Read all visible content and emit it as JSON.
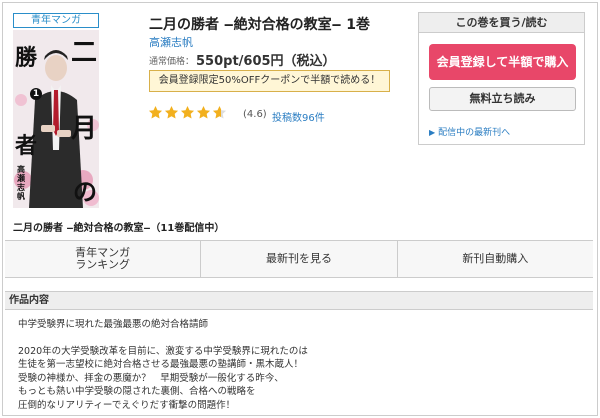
{
  "product": {
    "genre_badge": "青年マンガ",
    "title": "二月の勝者 ‒絶対合格の教室‒ 1巻",
    "author": "高瀬志帆",
    "price_label": "通常価格：",
    "price": "550pt/605円（税込）",
    "coupon": "会員登録限定50%OFFクーポンで半額で読める！",
    "rating": "(4.6)",
    "rating_value": 4.6,
    "review_link": "投稿数96件",
    "series_title": "二月の勝者 ‒絶対合格の教室‒（11巻配信中）"
  },
  "cover": {
    "title_chars": [
      "勝",
      "者",
      "二",
      "月",
      "の"
    ],
    "volume": "1",
    "author_vertical": "高瀬志帆"
  },
  "buy_box": {
    "header": "この巻を買う/読む",
    "register_button": "会員登録して半額で購入",
    "free_button": "無料立ち読み",
    "latest_link": "配信中の最新刊へ"
  },
  "nav": {
    "ranking_line1": "青年マンガ",
    "ranking_line2": "ランキング",
    "latest": "最新刊を見る",
    "auto_buy": "新刊自動購入"
  },
  "description": {
    "heading": "作品内容",
    "line1": "中学受験界に現れた最強最悪の絶対合格請師",
    "line2": "2020年の大学受験改革を目前に、激変する中学受験界に現れたのは",
    "line3": "生徒を第一志望校に絶対合格させる最強最悪の塾講師・黒木蔵人！",
    "line4": "受験の神様か、拝金の悪魔か？　早期受験が一般化する昨今、",
    "line5": "もっとも熱い中学受験の隠された裏側、合格への戦略を",
    "line6": "圧倒的なリアリティーでえぐりだす衝撃の問題作！"
  },
  "colors": {
    "accent_red": "#e84769",
    "link_blue": "#2a7dc2",
    "star_gold": "#f2b01e",
    "coupon_bg": "#fff6d6"
  }
}
